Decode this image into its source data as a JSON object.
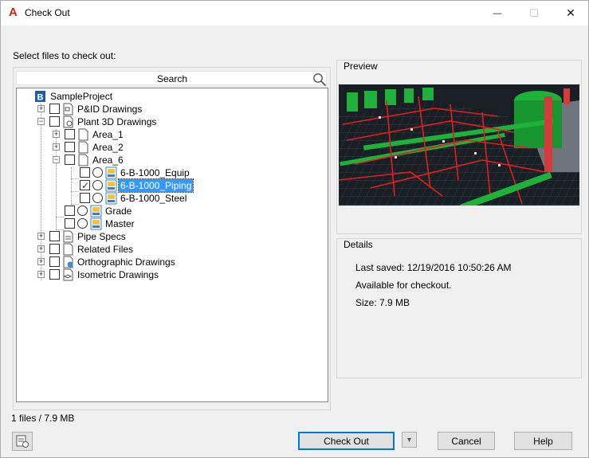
{
  "window": {
    "title": "Check Out",
    "app_icon_glyph": "A",
    "minimize_glyph": "—",
    "maximize_glyph": "☐",
    "close_glyph": "✕"
  },
  "prompt_label": "Select files to check out:",
  "search": {
    "label": "Search"
  },
  "tree": [
    {
      "label": "SampleProject",
      "type": "project-root",
      "checked": false,
      "selected": false
    },
    {
      "label": "P&ID Drawings",
      "type": "folder",
      "checked": false,
      "selected": false
    },
    {
      "label": "Plant 3D Drawings",
      "type": "folder",
      "checked": false,
      "selected": false
    },
    {
      "label": "Area_1",
      "type": "subfolder",
      "checked": false,
      "selected": false
    },
    {
      "label": "Area_2",
      "type": "subfolder",
      "checked": false,
      "selected": false
    },
    {
      "label": "Area_6",
      "type": "subfolder",
      "checked": false,
      "selected": false
    },
    {
      "label": "6-B-1000_Equip",
      "type": "drawing",
      "checked": false,
      "selected": false
    },
    {
      "label": "6-B-1000_Piping",
      "type": "drawing",
      "checked": true,
      "selected": true
    },
    {
      "label": "6-B-1000_Steel",
      "type": "drawing",
      "checked": false,
      "selected": false
    },
    {
      "label": "Grade",
      "type": "drawing",
      "checked": false,
      "selected": false
    },
    {
      "label": "Master",
      "type": "drawing",
      "checked": false,
      "selected": false
    },
    {
      "label": "Pipe Specs",
      "type": "folder",
      "checked": false,
      "selected": false
    },
    {
      "label": "Related Files",
      "type": "folder",
      "checked": false,
      "selected": false
    },
    {
      "label": "Orthographic Drawings",
      "type": "folder",
      "checked": false,
      "selected": false
    },
    {
      "label": "Isometric Drawings",
      "type": "folder",
      "checked": false,
      "selected": false
    }
  ],
  "preview": {
    "title": "Preview"
  },
  "details": {
    "title": "Details",
    "last_saved": "Last saved: 12/19/2016 10:50:26 AM",
    "availability": "Available for checkout.",
    "size": "Size: 7.9 MB"
  },
  "status": {
    "summary": "1 files / 7.9 MB"
  },
  "buttons": {
    "check_out": "Check Out",
    "dropdown_glyph": "▾",
    "cancel": "Cancel",
    "help": "Help"
  },
  "colors": {
    "selection": "#3399ff",
    "preview_background": "#1a1f25",
    "pipe_red": "#e02020",
    "equipment_green": "#1fb23a",
    "app_red": "#d21f24"
  }
}
